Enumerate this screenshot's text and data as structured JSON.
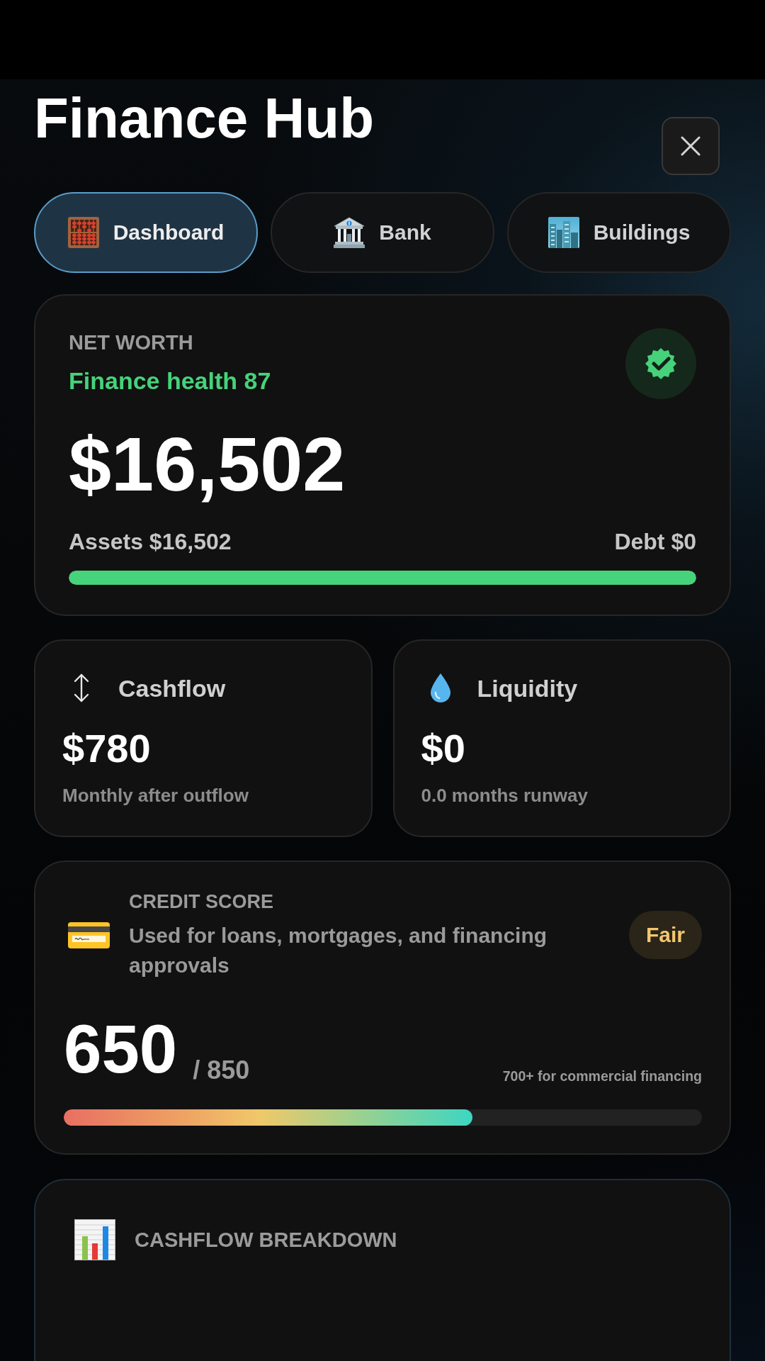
{
  "header": {
    "title": "Finance Hub"
  },
  "tabs": [
    {
      "label": "Dashboard",
      "selected": true
    },
    {
      "label": "Bank",
      "selected": false
    },
    {
      "label": "Buildings",
      "selected": false
    }
  ],
  "net_worth": {
    "label": "NET WORTH",
    "health": "Finance health 87",
    "value": "$16,502",
    "assets": "Assets $16,502",
    "debt": "Debt $0",
    "level": 1
  },
  "stats": [
    {
      "title": "Cashflow",
      "value": "$780",
      "caption": "Monthly after outflow"
    },
    {
      "title": "Liquidity",
      "value": "$0",
      "caption": "0.0 months runway"
    }
  ],
  "credit_score": {
    "label": "CREDIT SCORE",
    "description": "Used for loans, mortgages, and financing approvals",
    "rating": "Fair",
    "score": "650",
    "max": "/ 850",
    "note": "700+ for commercial financing",
    "level": 0.64
  },
  "breakdown": {
    "title": "CASHFLOW BREAKDOWN"
  }
}
